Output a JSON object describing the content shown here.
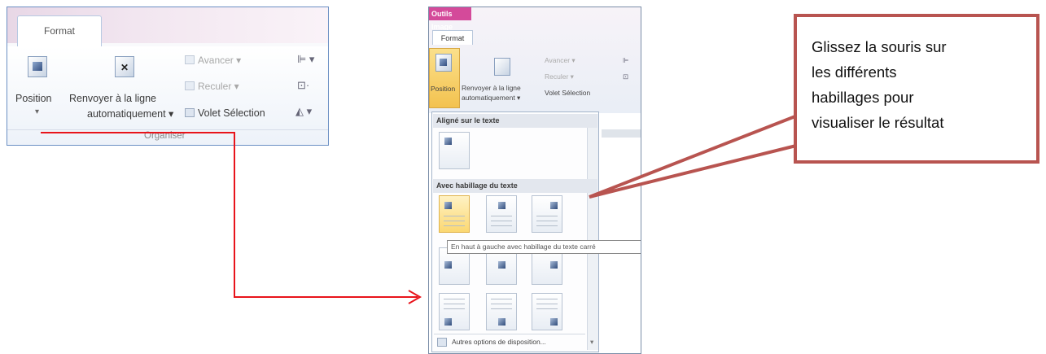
{
  "left_ribbon": {
    "tab_label": "Format",
    "position_label": "Position",
    "position_arrow": "▾",
    "wrap_label_line1": "Renvoyer à la ligne",
    "wrap_label_line2": "automatiquement ▾",
    "bring_forward": "Avancer ▾",
    "send_backward": "Reculer ▾",
    "selection_pane": "Volet Sélection",
    "group_label": "Organiser"
  },
  "dropdown_shot": {
    "context_tab": "Outils Image",
    "tab_label": "Format",
    "position_label": "Position",
    "wrap_label_line1": "Renvoyer à la ligne",
    "wrap_label_line2": "automatiquement ▾",
    "bring_forward": "Avancer ▾",
    "send_backward": "Reculer ▾",
    "selection_pane": "Volet Sélection",
    "section_inline": "Aligné sur le texte",
    "section_wrap": "Avec habillage du texte",
    "tooltip": "En haut à gauche avec habillage du texte carré",
    "more_options": "Autres options de disposition..."
  },
  "callout": {
    "line1": "Glissez la souris sur",
    "line2": "les différents",
    "line3": "habillages pour",
    "line4": "visualiser le résultat"
  },
  "colors": {
    "arrow": "#e8141b",
    "callout_border": "#b85450",
    "highlight": "#f3c24f"
  }
}
